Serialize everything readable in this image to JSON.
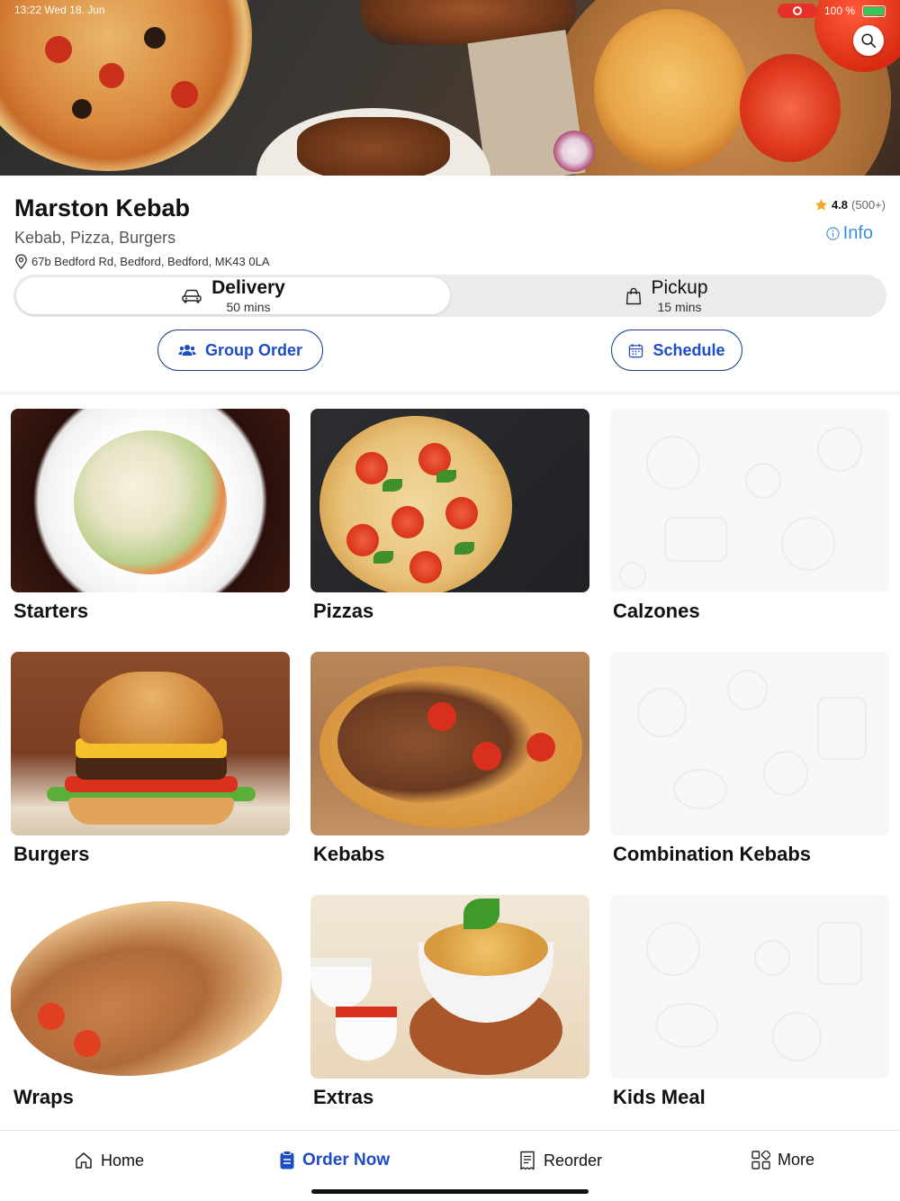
{
  "status_bar": {
    "time_date": "13:22  Wed 18. Jun",
    "battery": "100 %"
  },
  "restaurant": {
    "name": "Marston Kebab",
    "cuisine": "Kebab, Pizza, Burgers",
    "address": "67b Bedford Rd, Bedford, Bedford, MK43 0LA",
    "rating": "4.8",
    "review_count": "(500+)",
    "info_label": "Info"
  },
  "order_mode": {
    "selected": "Delivery",
    "options": [
      {
        "label": "Delivery",
        "time": "50 mins",
        "icon": "car-icon"
      },
      {
        "label": "Pickup",
        "time": "15 mins",
        "icon": "bag-icon"
      }
    ]
  },
  "actions": {
    "group_order": "Group Order",
    "schedule": "Schedule"
  },
  "categories": [
    {
      "name": "Starters",
      "image": "photo"
    },
    {
      "name": "Pizzas",
      "image": "photo"
    },
    {
      "name": "Calzones",
      "image": "placeholder"
    },
    {
      "name": "Burgers",
      "image": "photo"
    },
    {
      "name": "Kebabs",
      "image": "photo"
    },
    {
      "name": "Combination Kebabs",
      "image": "placeholder"
    },
    {
      "name": "Wraps",
      "image": "photo"
    },
    {
      "name": "Extras",
      "image": "photo"
    },
    {
      "name": "Kids Meal",
      "image": "placeholder"
    }
  ],
  "bottom_nav": [
    {
      "label": "Home",
      "icon": "home-icon",
      "active": false
    },
    {
      "label": "Order Now",
      "icon": "order-icon",
      "active": true
    },
    {
      "label": "Reorder",
      "icon": "receipt-icon",
      "active": false
    },
    {
      "label": "More",
      "icon": "grid-icon",
      "active": false
    }
  ],
  "colors": {
    "accent": "#1d4cc4",
    "info_link": "#3b8fd6",
    "star": "#f5a623",
    "record": "#e8302a"
  }
}
